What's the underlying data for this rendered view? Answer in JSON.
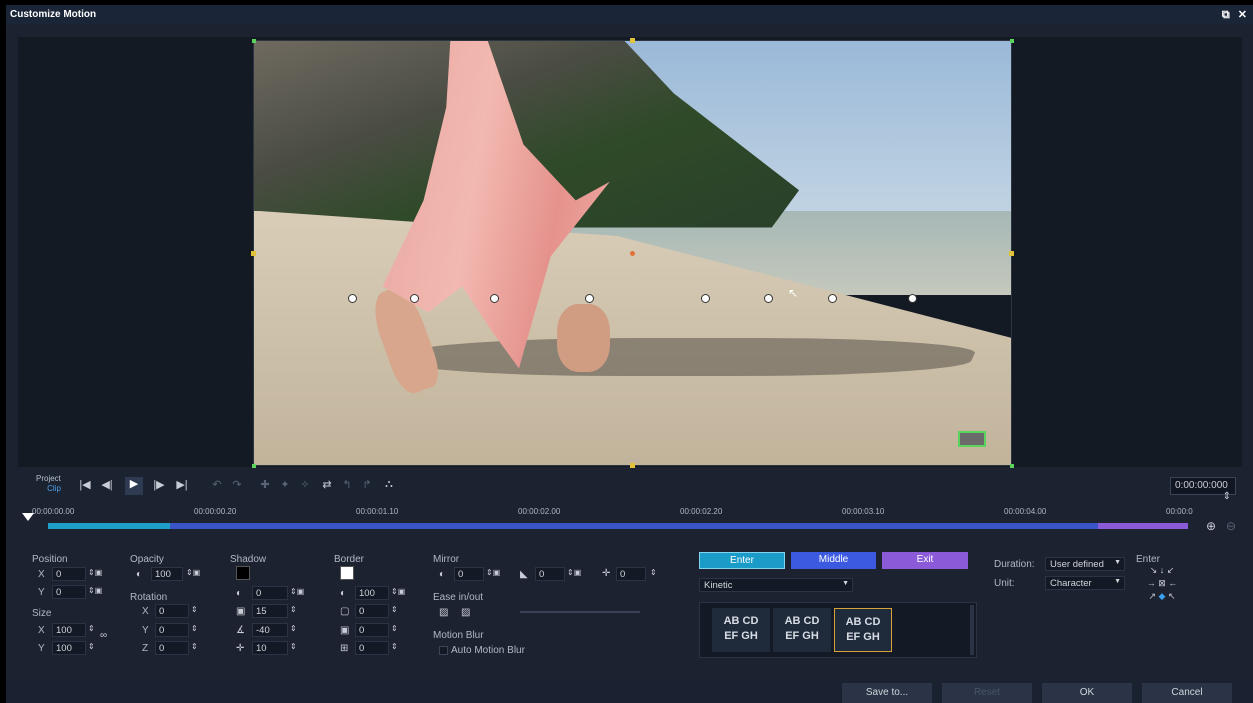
{
  "window": {
    "title": "Customize Motion",
    "restore_icon": "restore-icon",
    "close_icon": "close-icon",
    "restore_glyph": "⧉",
    "close_glyph": "✕"
  },
  "transport": {
    "project_label": "Project",
    "clip_label": "Clip",
    "timecode": "0:00:00:000"
  },
  "timeline": {
    "ruler": [
      "00:00:00.00",
      "00:00:00.20",
      "00:00:01.10",
      "00:00:02.00",
      "00:00:02.20",
      "00:00:03.10",
      "00:00:04.00",
      "00:00:0"
    ]
  },
  "position": {
    "title": "Position",
    "x_label": "X",
    "x": "0",
    "y_label": "Y",
    "y": "0"
  },
  "size": {
    "title": "Size",
    "x_label": "X",
    "x": "100",
    "y_label": "Y",
    "y": "100"
  },
  "opacity": {
    "title": "Opacity",
    "value": "100"
  },
  "rotation": {
    "title": "Rotation",
    "x_label": "X",
    "x": "0",
    "y_label": "Y",
    "y": "0",
    "z_label": "Z",
    "z": "0"
  },
  "shadow": {
    "title": "Shadow",
    "color": "#000000",
    "opacity": "0",
    "blur": "15",
    "angle": "-40",
    "distance": "10"
  },
  "border": {
    "title": "Border",
    "color": "#ffffff",
    "opacity": "100",
    "width": "0",
    "v1": "0",
    "v2": "0"
  },
  "mirror": {
    "title": "Mirror",
    "v1": "0",
    "v2": "0",
    "v3": "0"
  },
  "ease": {
    "title": "Ease in/out"
  },
  "motion_blur": {
    "title": "Motion Blur",
    "auto_label": "Auto Motion Blur"
  },
  "anim_tabs": {
    "enter": "Enter",
    "middle": "Middle",
    "exit": "Exit"
  },
  "style_select": "Kinetic",
  "presets": [
    {
      "line1": "AB CD",
      "line2": "EF GH"
    },
    {
      "line1": "AB CD",
      "line2": "EF GH"
    },
    {
      "line1": "AB CD",
      "line2": "EF GH"
    }
  ],
  "duration": {
    "label": "Duration:",
    "value": "User defined"
  },
  "unit": {
    "label": "Unit:",
    "value": "Character"
  },
  "direction": {
    "label": "Enter"
  },
  "buttons": {
    "save_to": "Save to...",
    "reset": "Reset",
    "ok": "OK",
    "cancel": "Cancel"
  },
  "colors": {
    "enter": "#1a9bc8",
    "middle": "#3b5ae0",
    "exit": "#8a5ad8"
  }
}
